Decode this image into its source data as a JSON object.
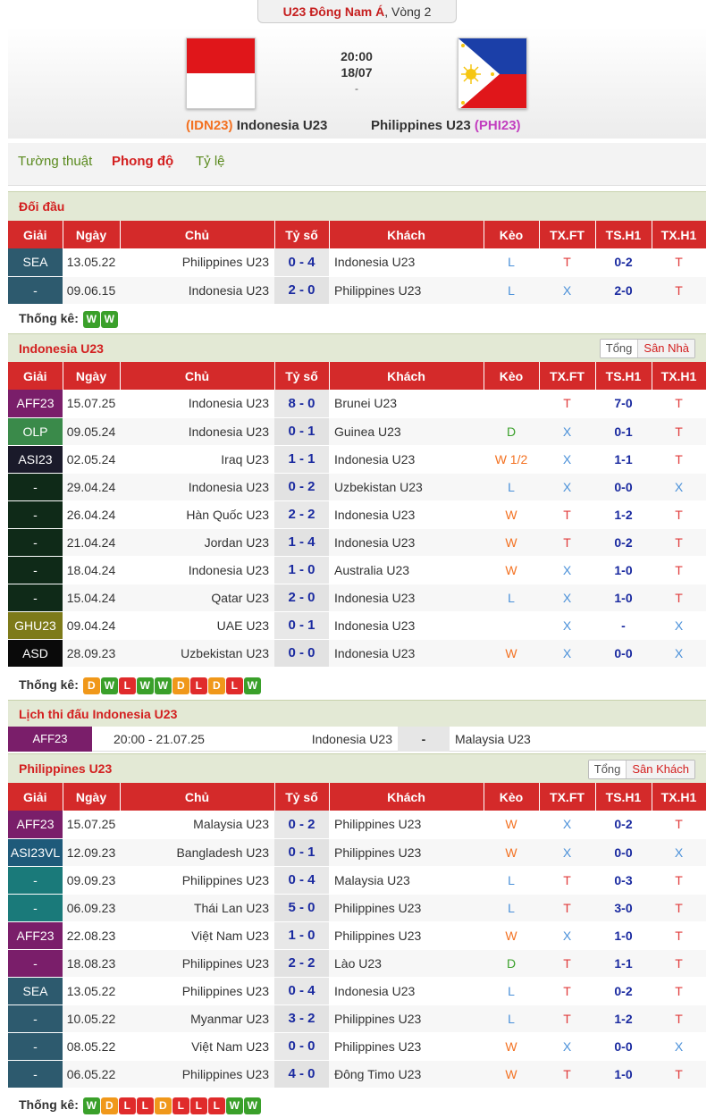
{
  "competition": {
    "name": "U23 Đông Nam Á",
    "round": ", Vòng 2"
  },
  "match": {
    "time": "20:00",
    "date": "18/07",
    "score": "-",
    "home": {
      "code": "(IDN23)",
      "name": "Indonesia U23"
    },
    "away": {
      "code": "(PHI23)",
      "name": "Philippines U23"
    }
  },
  "tabs": [
    "Tường thuật",
    "Phong độ",
    "Tỷ lệ"
  ],
  "columns": [
    "Giải",
    "Ngày",
    "Chủ",
    "Tỷ số",
    "Khách",
    "Kèo",
    "TX.FT",
    "TS.H1",
    "TX.H1"
  ],
  "stat_label": "Thống kê:",
  "h2h": {
    "title": "Đối đầu",
    "rows": [
      {
        "lg": "SEA",
        "c": "#2d5a6e",
        "date": "13.05.22",
        "home": "Philippines U23",
        "score": "0 - 4",
        "away": "Indonesia U23",
        "keo": "L",
        "txft": "T",
        "tsh1": "0-2",
        "txh1": "T"
      },
      {
        "lg": "-",
        "c": "#2d5a6e",
        "date": "09.06.15",
        "home": "Indonesia U23",
        "score": "2 - 0",
        "away": "Philippines U23",
        "keo": "L",
        "txft": "X",
        "tsh1": "2-0",
        "txh1": "T"
      }
    ],
    "form": [
      "W",
      "W"
    ]
  },
  "indo": {
    "title": "Indonesia U23",
    "toggle": [
      "Tổng",
      "Sân Nhà"
    ],
    "rows": [
      {
        "lg": "AFF23",
        "c": "#7a1e6a",
        "date": "15.07.25",
        "home": "Indonesia U23",
        "score": "8 - 0",
        "away": "Brunei U23",
        "keo": "",
        "txft": "T",
        "tsh1": "7-0",
        "txh1": "T"
      },
      {
        "lg": "OLP",
        "c": "#3a8a4a",
        "date": "09.05.24",
        "home": "Indonesia U23",
        "score": "0 - 1",
        "away": "Guinea U23",
        "keo": "D",
        "txft": "X",
        "tsh1": "0-1",
        "txh1": "T"
      },
      {
        "lg": "ASI23",
        "c": "#1a1a2a",
        "date": "02.05.24",
        "home": "Iraq U23",
        "score": "1 - 1",
        "away": "Indonesia U23",
        "keo": "W 1/2",
        "txft": "X",
        "tsh1": "1-1",
        "txh1": "T"
      },
      {
        "lg": "-",
        "c": "#0f2a18",
        "date": "29.04.24",
        "home": "Indonesia U23",
        "score": "0 - 2",
        "away": "Uzbekistan U23",
        "keo": "L",
        "txft": "X",
        "tsh1": "0-0",
        "txh1": "X"
      },
      {
        "lg": "-",
        "c": "#0f2a18",
        "date": "26.04.24",
        "home": "Hàn Quốc U23",
        "score": "2 - 2",
        "away": "Indonesia U23",
        "keo": "W",
        "txft": "T",
        "tsh1": "1-2",
        "txh1": "T"
      },
      {
        "lg": "-",
        "c": "#0f2a18",
        "date": "21.04.24",
        "home": "Jordan U23",
        "score": "1 - 4",
        "away": "Indonesia U23",
        "keo": "W",
        "txft": "T",
        "tsh1": "0-2",
        "txh1": "T"
      },
      {
        "lg": "-",
        "c": "#0f2a18",
        "date": "18.04.24",
        "home": "Indonesia U23",
        "score": "1 - 0",
        "away": "Australia U23",
        "keo": "W",
        "txft": "X",
        "tsh1": "1-0",
        "txh1": "T"
      },
      {
        "lg": "-",
        "c": "#0f2a18",
        "date": "15.04.24",
        "home": "Qatar U23",
        "score": "2 - 0",
        "away": "Indonesia U23",
        "keo": "L",
        "txft": "X",
        "tsh1": "1-0",
        "txh1": "T"
      },
      {
        "lg": "GHU23",
        "c": "#7d7a1a",
        "date": "09.04.24",
        "home": "UAE U23",
        "score": "0 - 1",
        "away": "Indonesia U23",
        "keo": "",
        "txft": "X",
        "tsh1": "-",
        "txh1": "X"
      },
      {
        "lg": "ASD",
        "c": "#0a0a0a",
        "date": "28.09.23",
        "home": "Uzbekistan U23",
        "score": "0 - 0",
        "away": "Indonesia U23",
        "keo": "W",
        "txft": "X",
        "tsh1": "0-0",
        "txh1": "X"
      }
    ],
    "form": [
      "D",
      "W",
      "L",
      "W",
      "W",
      "D",
      "L",
      "D",
      "L",
      "W"
    ]
  },
  "fixtures": {
    "title": "Lịch thi đấu Indonesia U23",
    "row": {
      "lg": "AFF23",
      "datetime": "20:00 - 21.07.25",
      "home": "Indonesia U23",
      "score": "-",
      "away": "Malaysia U23"
    }
  },
  "phil": {
    "title": "Philippines U23",
    "toggle": [
      "Tổng",
      "Sân Khách"
    ],
    "rows": [
      {
        "lg": "AFF23",
        "c": "#7a1e6a",
        "date": "15.07.25",
        "home": "Malaysia U23",
        "score": "0 - 2",
        "away": "Philippines U23",
        "keo": "W",
        "txft": "X",
        "tsh1": "0-2",
        "txh1": "T"
      },
      {
        "lg": "ASI23VL",
        "c": "#1e5a7a",
        "date": "12.09.23",
        "home": "Bangladesh U23",
        "score": "0 - 1",
        "away": "Philippines U23",
        "keo": "W",
        "txft": "X",
        "tsh1": "0-0",
        "txh1": "X"
      },
      {
        "lg": "-",
        "c": "#1a7a7a",
        "date": "09.09.23",
        "home": "Philippines U23",
        "score": "0 - 4",
        "away": "Malaysia U23",
        "keo": "L",
        "txft": "T",
        "tsh1": "0-3",
        "txh1": "T"
      },
      {
        "lg": "-",
        "c": "#1a7a7a",
        "date": "06.09.23",
        "home": "Thái Lan U23",
        "score": "5 - 0",
        "away": "Philippines U23",
        "keo": "L",
        "txft": "T",
        "tsh1": "3-0",
        "txh1": "T"
      },
      {
        "lg": "AFF23",
        "c": "#7a1e6a",
        "date": "22.08.23",
        "home": "Việt Nam U23",
        "score": "1 - 0",
        "away": "Philippines U23",
        "keo": "W",
        "txft": "X",
        "tsh1": "1-0",
        "txh1": "T"
      },
      {
        "lg": "-",
        "c": "#7a1e6a",
        "date": "18.08.23",
        "home": "Philippines U23",
        "score": "2 - 2",
        "away": "Lào U23",
        "keo": "D",
        "txft": "T",
        "tsh1": "1-1",
        "txh1": "T"
      },
      {
        "lg": "SEA",
        "c": "#2d5a6e",
        "date": "13.05.22",
        "home": "Philippines U23",
        "score": "0 - 4",
        "away": "Indonesia U23",
        "keo": "L",
        "txft": "T",
        "tsh1": "0-2",
        "txh1": "T"
      },
      {
        "lg": "-",
        "c": "#2d5a6e",
        "date": "10.05.22",
        "home": "Myanmar U23",
        "score": "3 - 2",
        "away": "Philippines U23",
        "keo": "L",
        "txft": "T",
        "tsh1": "1-2",
        "txh1": "T"
      },
      {
        "lg": "-",
        "c": "#2d5a6e",
        "date": "08.05.22",
        "home": "Việt Nam U23",
        "score": "0 - 0",
        "away": "Philippines U23",
        "keo": "W",
        "txft": "X",
        "tsh1": "0-0",
        "txh1": "X"
      },
      {
        "lg": "-",
        "c": "#2d5a6e",
        "date": "06.05.22",
        "home": "Philippines U23",
        "score": "4 - 0",
        "away": "Đông Timo U23",
        "keo": "W",
        "txft": "T",
        "tsh1": "1-0",
        "txh1": "T"
      }
    ],
    "form": [
      "W",
      "D",
      "L",
      "L",
      "D",
      "L",
      "L",
      "L",
      "W",
      "W"
    ]
  }
}
